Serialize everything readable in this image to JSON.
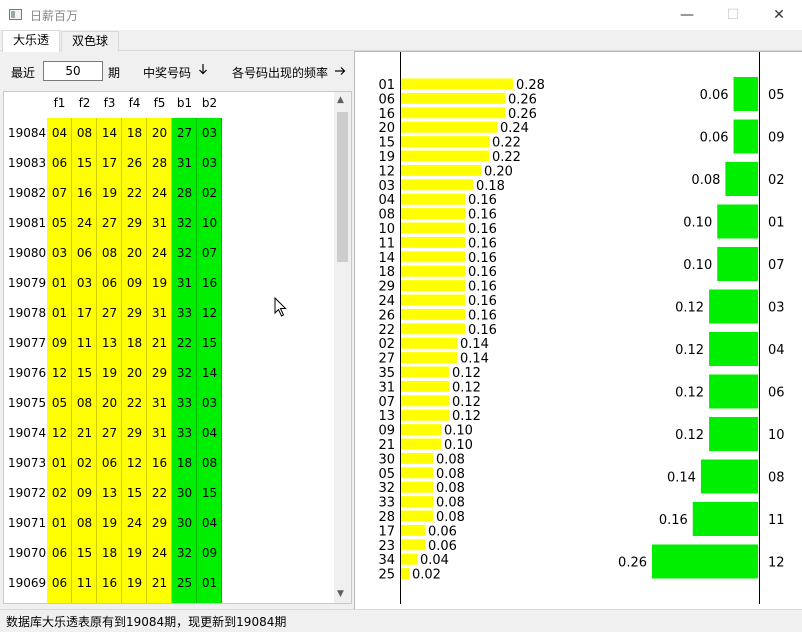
{
  "window": {
    "title": "日薪百万",
    "minimize_glyph": "—",
    "maximize_glyph": "☐",
    "close_glyph": "✕"
  },
  "tabs": [
    {
      "label": "大乐透",
      "active": true
    },
    {
      "label": "双色球",
      "active": false
    }
  ],
  "controls": {
    "recent_label": "最近",
    "period_value": "50",
    "period_unit": "期",
    "win_numbers_label": "中奖号码",
    "win_numbers_icon": "arrow-down-icon",
    "frequency_label": "各号码出现的频率",
    "frequency_icon": "arrow-right-icon"
  },
  "table": {
    "columns": [
      "f1",
      "f2",
      "f3",
      "f4",
      "f5",
      "b1",
      "b2"
    ],
    "rows": [
      {
        "period": "19084",
        "nums": [
          "04",
          "08",
          "14",
          "18",
          "20",
          "27",
          "03"
        ]
      },
      {
        "period": "19083",
        "nums": [
          "06",
          "15",
          "17",
          "26",
          "28",
          "31",
          "03"
        ]
      },
      {
        "period": "19082",
        "nums": [
          "07",
          "16",
          "19",
          "22",
          "24",
          "28",
          "02"
        ]
      },
      {
        "period": "19081",
        "nums": [
          "05",
          "24",
          "27",
          "29",
          "31",
          "32",
          "10"
        ]
      },
      {
        "period": "19080",
        "nums": [
          "03",
          "06",
          "08",
          "20",
          "24",
          "32",
          "07"
        ]
      },
      {
        "period": "19079",
        "nums": [
          "01",
          "03",
          "06",
          "09",
          "19",
          "31",
          "16"
        ]
      },
      {
        "period": "19078",
        "nums": [
          "01",
          "17",
          "27",
          "29",
          "31",
          "33",
          "12"
        ]
      },
      {
        "period": "19077",
        "nums": [
          "09",
          "11",
          "13",
          "18",
          "21",
          "22",
          "15"
        ]
      },
      {
        "period": "19076",
        "nums": [
          "12",
          "15",
          "19",
          "20",
          "29",
          "32",
          "14"
        ]
      },
      {
        "period": "19075",
        "nums": [
          "05",
          "08",
          "20",
          "22",
          "31",
          "33",
          "03"
        ]
      },
      {
        "period": "19074",
        "nums": [
          "12",
          "21",
          "27",
          "29",
          "31",
          "33",
          "04"
        ]
      },
      {
        "period": "19073",
        "nums": [
          "01",
          "02",
          "06",
          "12",
          "16",
          "18",
          "08"
        ]
      },
      {
        "period": "19072",
        "nums": [
          "02",
          "09",
          "13",
          "15",
          "22",
          "30",
          "15"
        ]
      },
      {
        "period": "19071",
        "nums": [
          "01",
          "08",
          "19",
          "24",
          "29",
          "30",
          "04"
        ]
      },
      {
        "period": "19070",
        "nums": [
          "06",
          "15",
          "18",
          "19",
          "24",
          "32",
          "09"
        ]
      },
      {
        "period": "19069",
        "nums": [
          "06",
          "11",
          "16",
          "19",
          "21",
          "25",
          "01"
        ]
      }
    ],
    "colors": {
      "front": "#ffff00",
      "back": "#00ee00"
    }
  },
  "chart_data": [
    {
      "type": "bar",
      "orientation": "horizontal",
      "color": "#ffff00",
      "categories": [
        "01",
        "06",
        "16",
        "20",
        "15",
        "19",
        "12",
        "03",
        "04",
        "08",
        "10",
        "11",
        "14",
        "18",
        "29",
        "24",
        "26",
        "22",
        "02",
        "27",
        "35",
        "31",
        "07",
        "13",
        "09",
        "21",
        "30",
        "05",
        "32",
        "33",
        "28",
        "17",
        "23",
        "34",
        "25"
      ],
      "values": [
        0.28,
        0.26,
        0.26,
        0.24,
        0.22,
        0.22,
        0.2,
        0.18,
        0.16,
        0.16,
        0.16,
        0.16,
        0.16,
        0.16,
        0.16,
        0.16,
        0.16,
        0.16,
        0.14,
        0.14,
        0.12,
        0.12,
        0.12,
        0.12,
        0.1,
        0.1,
        0.08,
        0.08,
        0.08,
        0.08,
        0.08,
        0.06,
        0.06,
        0.04,
        0.02
      ],
      "value_labels": [
        "0.28",
        "0.26",
        "0.26",
        "0.24",
        "0.22",
        "0.22",
        "0.20",
        "0.18",
        "0.16",
        "0.16",
        "0.16",
        "0.16",
        "0.16",
        "0.16",
        "0.16",
        "0.16",
        "0.16",
        "0.16",
        "0.14",
        "0.14",
        "0.12",
        "0.12",
        "0.12",
        "0.12",
        "0.10",
        "0.10",
        "0.08",
        "0.08",
        "0.08",
        "0.08",
        "0.08",
        "0.06",
        "0.06",
        "0.04",
        "0.02"
      ],
      "xlim": [
        0,
        0.28
      ]
    },
    {
      "type": "bar",
      "orientation": "horizontal-reversed",
      "color": "#00ee00",
      "categories": [
        "05",
        "09",
        "02",
        "01",
        "07",
        "03",
        "04",
        "06",
        "10",
        "08",
        "11",
        "12"
      ],
      "values": [
        0.06,
        0.06,
        0.08,
        0.1,
        0.1,
        0.12,
        0.12,
        0.12,
        0.12,
        0.14,
        0.16,
        0.26
      ],
      "value_labels": [
        "0.06",
        "0.06",
        "0.08",
        "0.10",
        "0.10",
        "0.12",
        "0.12",
        "0.12",
        "0.12",
        "0.14",
        "0.16",
        "0.26"
      ],
      "xlim": [
        0,
        0.26
      ]
    }
  ],
  "status": {
    "text": "数据库大乐透表原有到19084期，现更新到19084期"
  }
}
